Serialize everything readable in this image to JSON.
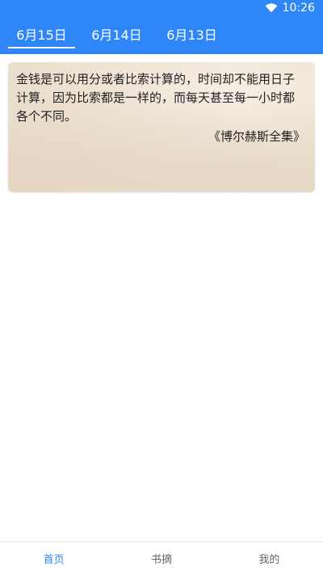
{
  "status_bar": {
    "time": "10:26",
    "wifi_icon": "wifi-icon"
  },
  "tabs": [
    {
      "label": "6月15日",
      "active": true
    },
    {
      "label": "6月14日",
      "active": false
    },
    {
      "label": "6月13日",
      "active": false
    }
  ],
  "quote": {
    "text": "金钱是可以用分或者比索计算的，时间却不能用日子计算，因为比索都是一样的，而每天甚至每一小时都各个不同。",
    "source": "《博尔赫斯全集》"
  },
  "bottom_nav": [
    {
      "label": "首页",
      "active": true
    },
    {
      "label": "书摘",
      "active": false
    },
    {
      "label": "我的",
      "active": false
    }
  ],
  "colors": {
    "primary": "#2f86f6",
    "card_background": "#efe3d3"
  }
}
